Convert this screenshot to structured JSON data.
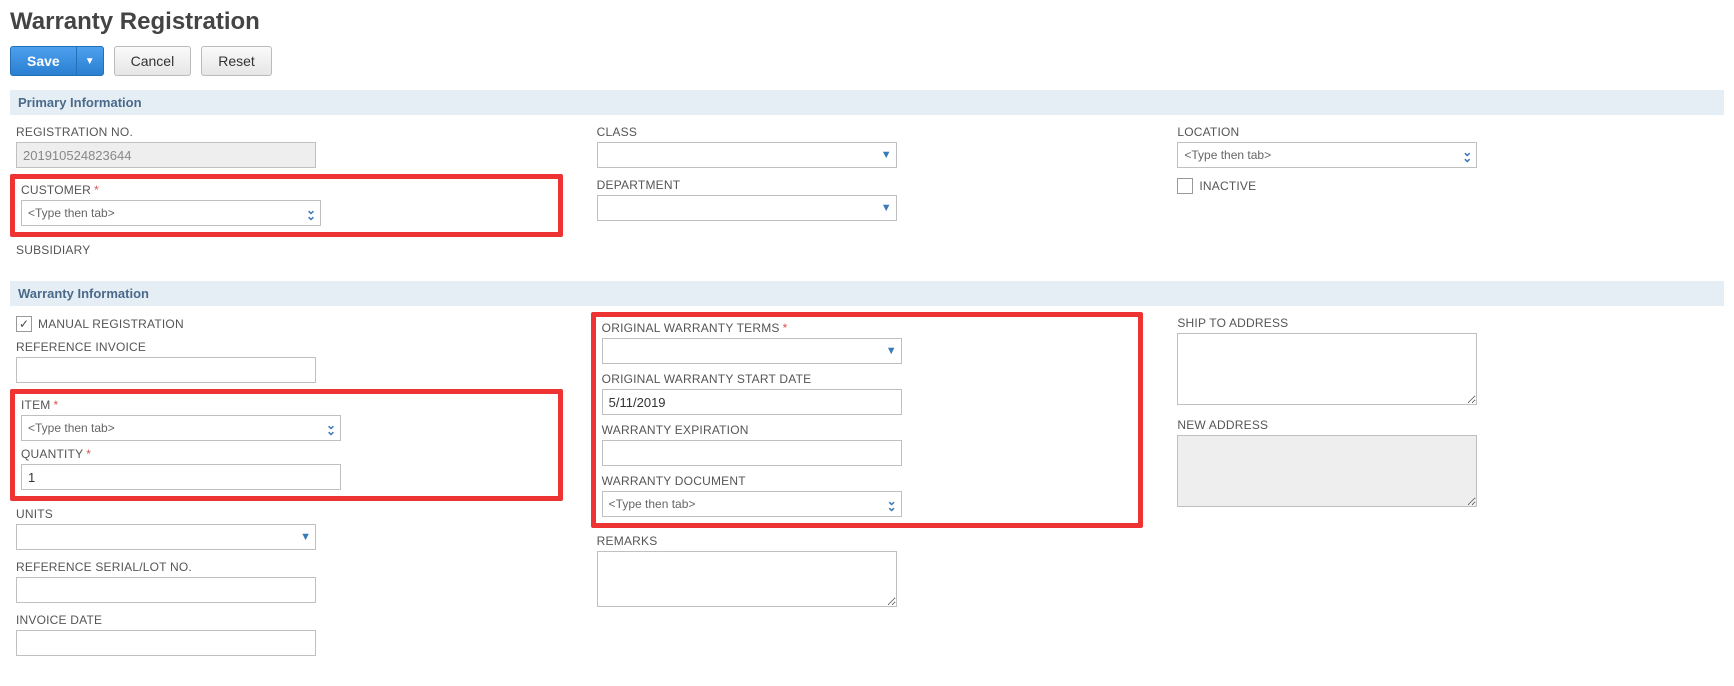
{
  "page_title": "Warranty Registration",
  "actions": {
    "save": "Save",
    "cancel": "Cancel",
    "reset": "Reset"
  },
  "sections": {
    "primary": "Primary Information",
    "warranty": "Warranty Information"
  },
  "primary": {
    "registration_no": {
      "label": "REGISTRATION NO.",
      "value": "201910524823644"
    },
    "customer": {
      "label": "CUSTOMER",
      "placeholder": "<Type then tab>"
    },
    "subsidiary": {
      "label": "SUBSIDIARY"
    },
    "class": {
      "label": "CLASS"
    },
    "department": {
      "label": "DEPARTMENT"
    },
    "location": {
      "label": "LOCATION",
      "placeholder": "<Type then tab>"
    },
    "inactive": {
      "label": "INACTIVE",
      "checked": false
    }
  },
  "warranty": {
    "manual_registration": {
      "label": "MANUAL REGISTRATION",
      "checked": true
    },
    "reference_invoice": {
      "label": "REFERENCE INVOICE",
      "value": ""
    },
    "item": {
      "label": "ITEM",
      "placeholder": "<Type then tab>"
    },
    "quantity": {
      "label": "QUANTITY",
      "value": "1"
    },
    "units": {
      "label": "UNITS"
    },
    "reference_serial": {
      "label": "REFERENCE SERIAL/LOT NO.",
      "value": ""
    },
    "invoice_date": {
      "label": "INVOICE DATE",
      "value": ""
    },
    "orig_terms": {
      "label": "ORIGINAL WARRANTY TERMS"
    },
    "orig_start": {
      "label": "ORIGINAL WARRANTY START DATE",
      "value": "5/11/2019"
    },
    "expiration": {
      "label": "WARRANTY EXPIRATION",
      "value": ""
    },
    "document": {
      "label": "WARRANTY DOCUMENT",
      "placeholder": "<Type then tab>"
    },
    "remarks": {
      "label": "REMARKS",
      "value": ""
    },
    "ship_to": {
      "label": "SHIP TO ADDRESS",
      "value": ""
    },
    "new_address": {
      "label": "NEW ADDRESS",
      "value": ""
    }
  }
}
